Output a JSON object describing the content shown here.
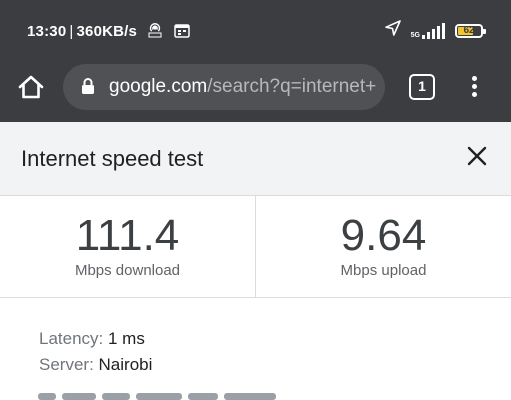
{
  "status_bar": {
    "time": "13:30",
    "speed": "360KB/s",
    "network_type": "5G",
    "battery_level": "62",
    "battery_color": "#f4c531"
  },
  "toolbar": {
    "url_host": "google.com",
    "url_path": "/search?q=internet+",
    "tab_count": "1"
  },
  "card": {
    "title": "Internet speed test"
  },
  "metrics": {
    "download_value": "111.4",
    "download_unit": "Mbps download",
    "upload_value": "9.64",
    "upload_unit": "Mbps upload"
  },
  "details": {
    "latency_label": "Latency:",
    "latency_value": "1 ms",
    "server_label": "Server:",
    "server_value": "Nairobi"
  },
  "icons": {
    "home": "home-icon",
    "lock": "lock-icon",
    "tabs": "tab-switcher-icon",
    "menu": "more-vert-icon",
    "close": "close-icon",
    "location": "location-arrow-icon",
    "signal": "signal-icon",
    "battery": "battery-icon",
    "hotspot": "hotspot-icon",
    "calendar": "calendar-icon"
  }
}
